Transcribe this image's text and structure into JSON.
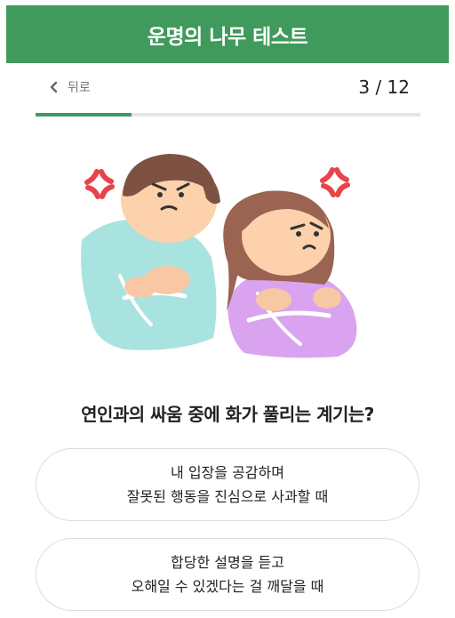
{
  "header": {
    "title": "운명의 나무 테스트"
  },
  "nav": {
    "back_label": "뒤로",
    "counter": "3 / 12"
  },
  "progress": {
    "current": 3,
    "total": 12,
    "fraction": 0.25
  },
  "colors": {
    "brand": "#3f9a5c",
    "track": "#e5e5e5",
    "anger": "#e8434b"
  },
  "question": {
    "text": "연인과의 싸움 중에 화가 풀리는 계기는?"
  },
  "options": [
    {
      "line1": "내 입장을 공감하며",
      "line2": "잘못된 행동을 진심으로 사과할 때"
    },
    {
      "line1": "합당한 설명을 듣고",
      "line2": "오해일 수 있겠다는 걸 깨달을 때"
    }
  ],
  "icons": {
    "back": "chevron-left-icon",
    "anger": "anger-symbol-icon"
  }
}
